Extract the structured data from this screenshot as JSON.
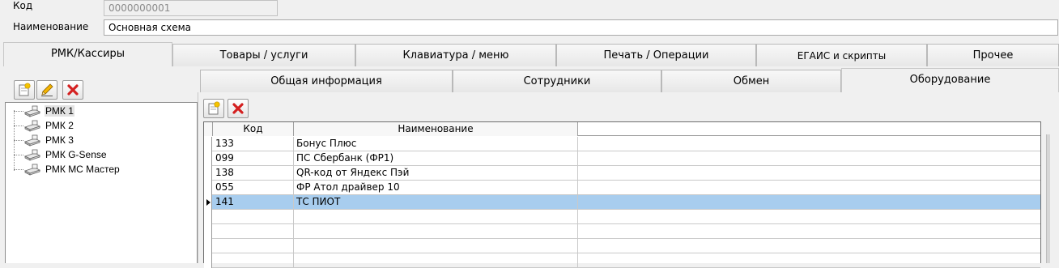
{
  "form": {
    "code_label": "Код",
    "code_value": "0000000001",
    "name_label": "Наименование",
    "name_value": "Основная схема"
  },
  "main_tabs": [
    {
      "label": "РМК/Кассиры",
      "active": true
    },
    {
      "label": "Товары / услуги",
      "active": false
    },
    {
      "label": "Клавиатура / меню",
      "active": false
    },
    {
      "label": "Печать / Операции",
      "active": false
    },
    {
      "label": "ЕГАИС и скрипты",
      "active": false
    },
    {
      "label": "Прочее",
      "active": false
    }
  ],
  "sub_tabs": [
    {
      "label": "Общая информация",
      "active": false
    },
    {
      "label": "Сотрудники",
      "active": false
    },
    {
      "label": "Обмен",
      "active": false
    },
    {
      "label": "Оборудование",
      "active": true
    }
  ],
  "left_toolbar": {
    "buttons": [
      {
        "icon": "add-icon"
      },
      {
        "icon": "edit-pencil-icon"
      },
      {
        "icon": "delete-x-icon"
      }
    ]
  },
  "tree": {
    "icon": "cash-register-icon",
    "items": [
      {
        "label": "РМК 1",
        "selected": true
      },
      {
        "label": "РМК 2",
        "selected": false
      },
      {
        "label": "РМК 3",
        "selected": false
      },
      {
        "label": "РМК G-Sense",
        "selected": false
      },
      {
        "label": "РМК МС Мастер",
        "selected": false
      }
    ]
  },
  "equipment_toolbar": {
    "buttons": [
      {
        "icon": "add-icon"
      },
      {
        "icon": "delete-x-icon"
      }
    ]
  },
  "equipment_grid": {
    "columns": [
      "Код",
      "Наименование"
    ],
    "rows": [
      {
        "code": "133",
        "name": "Бонус Плюс",
        "selected": false
      },
      {
        "code": "099",
        "name": "ПС Сбербанк (ФР1)",
        "selected": false
      },
      {
        "code": "138",
        "name": "QR-код от Яндекс Пэй",
        "selected": false
      },
      {
        "code": "055",
        "name": "ФР Атол драйвер 10",
        "selected": false
      },
      {
        "code": "141",
        "name": "ТС ПИОТ",
        "selected": true
      }
    ],
    "selected_color": "#a8cdee"
  },
  "colors": {
    "window_bg": "#f0f0f0",
    "delete_red": "#d42020"
  }
}
